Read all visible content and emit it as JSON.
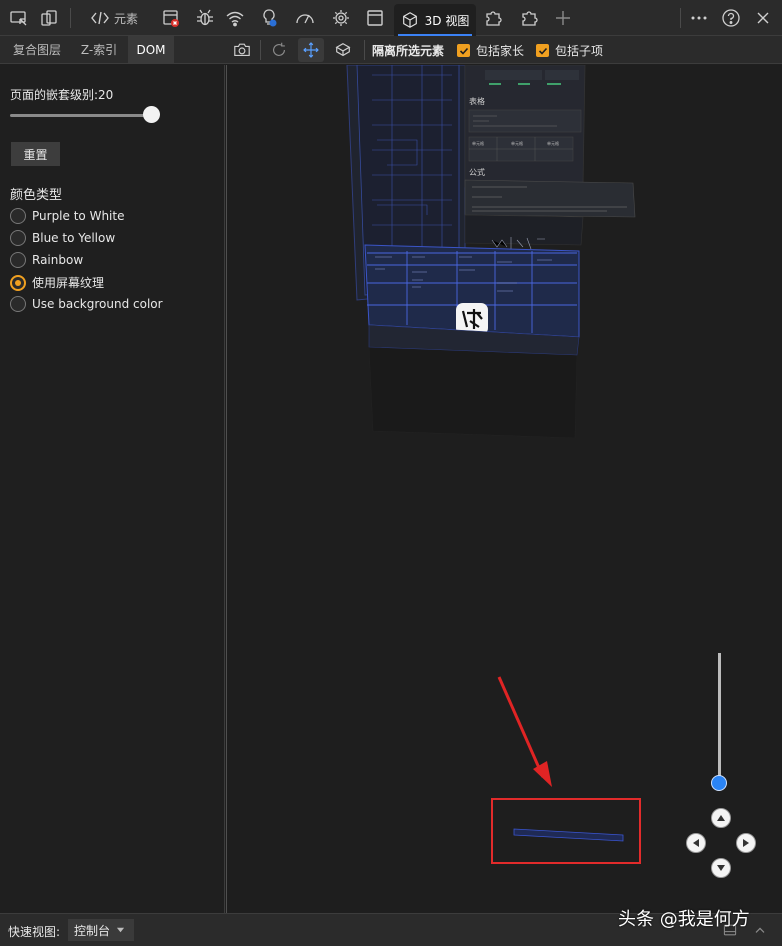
{
  "toolbar": {
    "elements_label": "元素",
    "view3d_label": "3D 视图",
    "icons": [
      "inspect-icon",
      "device-icon",
      "code-icon",
      "network-error-icon",
      "bug-icon",
      "wifi-icon",
      "bulb-icon",
      "performance-icon",
      "gear-chip-icon",
      "window-icon",
      "cube-icon",
      "puzzle-icon",
      "puzzle-outline-icon",
      "add-icon",
      "more-icon",
      "help-icon",
      "close-icon"
    ]
  },
  "subtabs": [
    "复合图层",
    "Z-索引",
    "DOM"
  ],
  "view_options": {
    "isolate_label": "隔离所选元素",
    "include_parents_label": "包括家长",
    "include_children_label": "包括子项",
    "include_parents_checked": true,
    "include_children_checked": true
  },
  "left_panel": {
    "nesting_label": "页面的嵌套级别:20",
    "nesting_level": 20,
    "reset_label": "重置",
    "color_type_title": "颜色类型",
    "color_options": [
      {
        "label": "Purple to White",
        "selected": false
      },
      {
        "label": "Blue to Yellow",
        "selected": false
      },
      {
        "label": "Rainbow",
        "selected": false
      },
      {
        "label": "使用屏幕纹理",
        "selected": true
      },
      {
        "label": "Use background color",
        "selected": false
      }
    ]
  },
  "scene": {
    "sections": [
      "表格",
      "公式"
    ],
    "table_cells": [
      "单元格",
      "单元格",
      "单元格"
    ]
  },
  "bottom": {
    "quick_view_label": "快速视图:",
    "quick_view_value": "控制台"
  },
  "watermark": "头条 @我是何方",
  "colors": {
    "accent": "#3b82f6",
    "checkbox": "#f0a020",
    "highlight_box": "#e22b2b",
    "zoom_knob": "#2a84f5"
  }
}
